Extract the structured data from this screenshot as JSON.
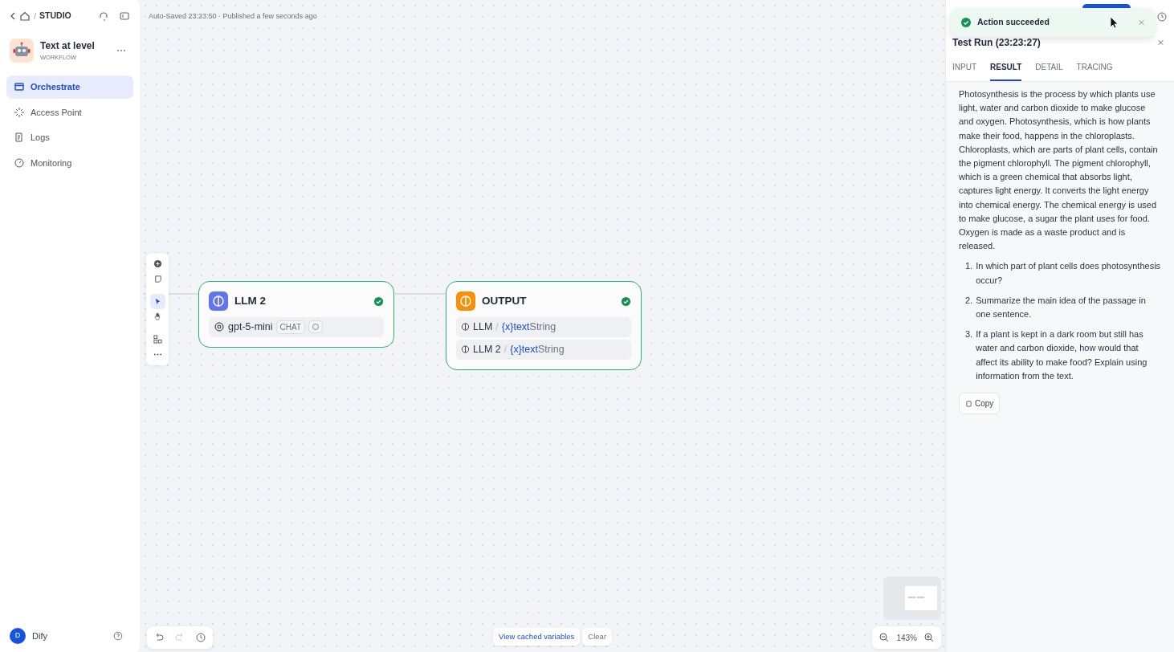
{
  "breadcrumb": {
    "separator": "/",
    "section": "STUDIO"
  },
  "app": {
    "name": "Text at level",
    "type": "WORKFLOW"
  },
  "nav": [
    {
      "label": "Orchestrate",
      "selected": true
    },
    {
      "label": "Access Point",
      "selected": false
    },
    {
      "label": "Logs",
      "selected": false
    },
    {
      "label": "Monitoring",
      "selected": false
    }
  ],
  "user": {
    "initial": "D",
    "name": "Dify"
  },
  "status": "Auto-Saved 23:23:50 · Published a few seconds ago",
  "nodes": [
    {
      "title": "LLM 2",
      "kind": "llm",
      "rows": [
        {
          "model": "gpt-5-mini",
          "tag": "CHAT"
        }
      ]
    },
    {
      "title": "OUTPUT",
      "kind": "output",
      "rows": [
        {
          "source": "LLM",
          "separator": "/",
          "var": "{x}",
          "name": "text",
          "type": "String"
        },
        {
          "source": "LLM 2",
          "separator": "/",
          "var": "{x}",
          "name": "text",
          "type": "String"
        }
      ]
    }
  ],
  "cache": {
    "link": "View cached variables",
    "clear": "Clear"
  },
  "zoom": "143%",
  "toast": {
    "message": "Action succeeded"
  },
  "panel": {
    "title": "Test Run (23:23:27)",
    "tabs": [
      {
        "label": "INPUT",
        "selected": false
      },
      {
        "label": "RESULT",
        "selected": true
      },
      {
        "label": "DETAIL",
        "selected": false
      },
      {
        "label": "TRACING",
        "selected": false
      }
    ],
    "paragraph": "Photosynthesis is the process by which plants use light, water and carbon dioxide to make glucose and oxygen. Photosynthesis, which is how plants make their food, happens in the chloroplasts. Chloroplasts, which are parts of plant cells, contain the pigment chlorophyll. The pigment chlorophyll, which is a green chemical that absorbs light, captures light energy. It converts the light energy into chemical energy. The chemical energy is used to make glucose, a sugar the plant uses for food. Oxygen is made as a waste product and is released.",
    "questions": [
      {
        "number": "1.",
        "text": "In which part of plant cells does photosynthesis occur?"
      },
      {
        "number": "2.",
        "text": "Summarize the main idea of the passage in one sentence."
      },
      {
        "number": "3.",
        "text": "If a plant is kept in a dark room but still has water and carbon dioxide, how would that affect its ability to make food? Explain using information from the text."
      }
    ],
    "copy": "Copy"
  }
}
